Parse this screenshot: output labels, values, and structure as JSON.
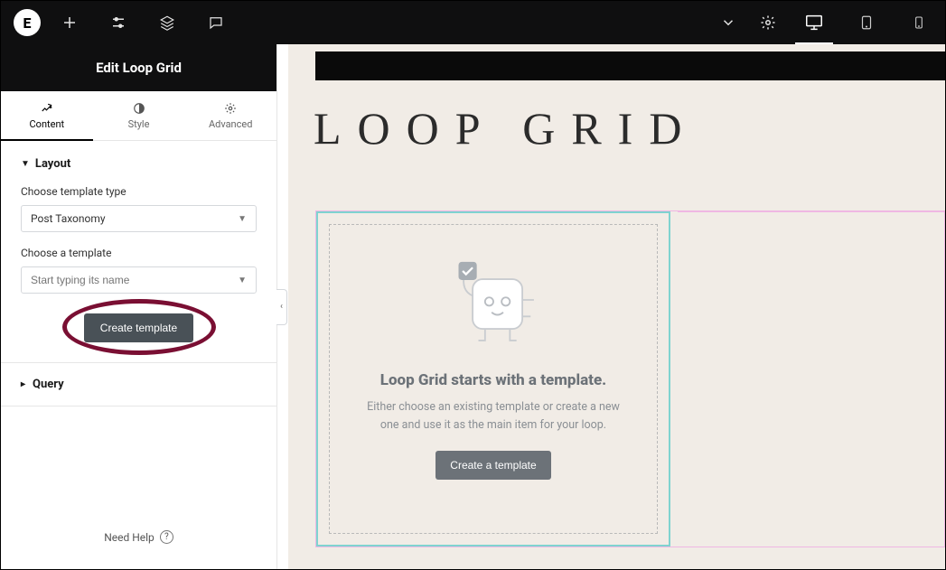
{
  "topbar": {
    "logo_letter": "E"
  },
  "panel": {
    "title": "Edit Loop Grid",
    "tabs": {
      "content": "Content",
      "style": "Style",
      "advanced": "Advanced"
    },
    "layout": {
      "section_label": "Layout",
      "template_type_label": "Choose template type",
      "template_type_value": "Post Taxonomy",
      "choose_template_label": "Choose a template",
      "choose_template_placeholder": "Start typing its name",
      "create_template_btn": "Create template"
    },
    "query": {
      "section_label": "Query"
    },
    "help_label": "Need Help"
  },
  "canvas": {
    "page_title": "LOOP GRID",
    "cell_heading": "Loop Grid starts with a template.",
    "cell_paragraph": "Either choose an existing template or create a new one and use it as the main item for your loop.",
    "cell_button": "Create a template"
  }
}
